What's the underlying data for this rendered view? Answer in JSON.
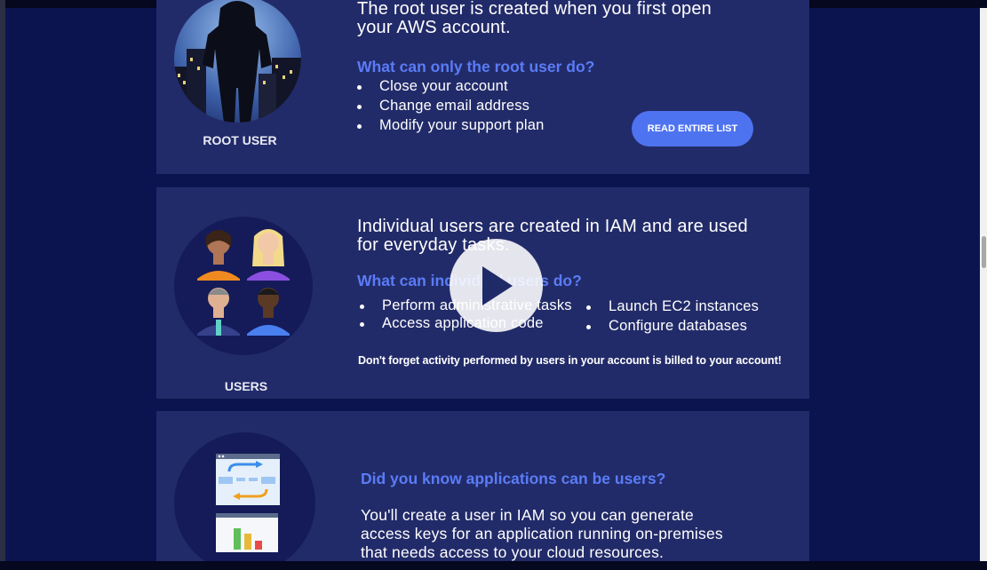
{
  "root_user_section": {
    "intro": "The root user is created when you first open your AWS account.",
    "heading": "What can only the root user do?",
    "bullets": [
      "Close your account",
      "Change email address",
      "Modify your support plan"
    ],
    "caption": "ROOT USER",
    "button_label": "READ ENTIRE LIST"
  },
  "users_section": {
    "intro": "Individual users are created in IAM and are used for everyday tasks.",
    "heading": "What can individual users do?",
    "bullets_left": [
      "Perform administrative tasks",
      "Access application code"
    ],
    "bullets_right": [
      "Launch EC2 instances",
      "Configure databases"
    ],
    "note": "Don't forget activity performed by users in your account is billed to your account!",
    "caption": "USERS"
  },
  "apps_section": {
    "heading": "Did you know applications can be users?",
    "body": "You'll create a user in IAM so you can generate access keys for an application running on-premises that needs access to your cloud resources."
  },
  "video": {
    "play_icon": "play-icon"
  },
  "colors": {
    "background": "#0c1450",
    "panel": "#222b69",
    "accent": "#5a7cf6",
    "button": "#4e73f0"
  }
}
